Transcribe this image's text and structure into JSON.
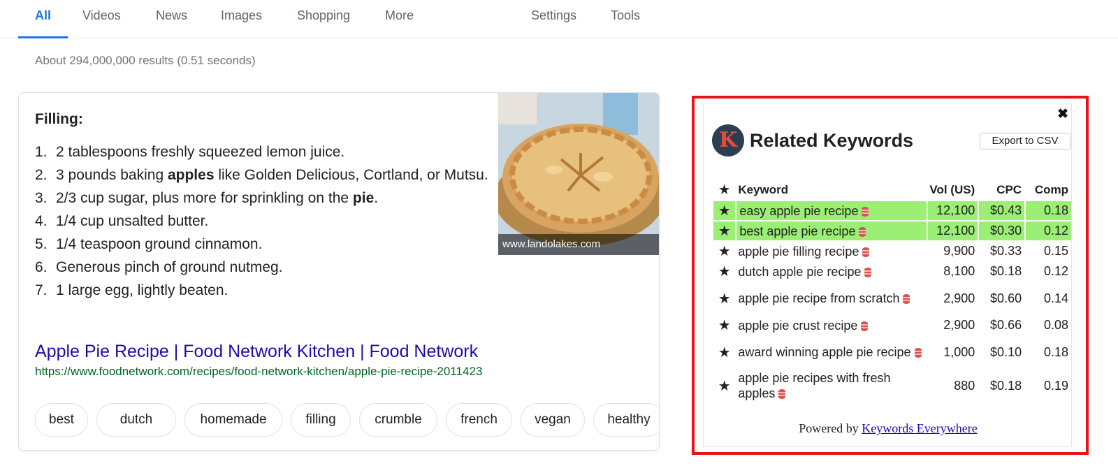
{
  "nav": {
    "tabs": [
      "All",
      "Videos",
      "News",
      "Images",
      "Shopping",
      "More"
    ],
    "right": [
      "Settings",
      "Tools"
    ]
  },
  "stats": "About 294,000,000 results (0.51 seconds)",
  "snippet": {
    "heading": "Filling:",
    "steps": [
      {
        "n": "1.",
        "parts": [
          [
            "2 tablespoons freshly squeezed lemon juice.",
            false
          ]
        ]
      },
      {
        "n": "2.",
        "parts": [
          [
            "3 pounds baking ",
            false
          ],
          [
            "apples",
            true
          ],
          [
            " like Golden Delicious, Cortland, or Mutsu.",
            false
          ]
        ]
      },
      {
        "n": "3.",
        "parts": [
          [
            "2/3 cup sugar, plus more for sprinkling on the ",
            false
          ],
          [
            "pie",
            true
          ],
          [
            ".",
            false
          ]
        ]
      },
      {
        "n": "4.",
        "parts": [
          [
            "1/4 cup unsalted butter.",
            false
          ]
        ]
      },
      {
        "n": "5.",
        "parts": [
          [
            "1/4 teaspoon ground cinnamon.",
            false
          ]
        ]
      },
      {
        "n": "6.",
        "parts": [
          [
            "Generous pinch of ground nutmeg.",
            false
          ]
        ]
      },
      {
        "n": "7.",
        "parts": [
          [
            "1 large egg, lightly beaten.",
            false
          ]
        ]
      }
    ],
    "image_caption": "www.landolakes.com",
    "result_title": "Apple Pie Recipe | Food Network Kitchen | Food Network",
    "result_url": "https://www.foodnetwork.com/recipes/food-network-kitchen/apple-pie-recipe-2011423",
    "chips": [
      "best",
      "dutch",
      "homemade",
      "filling",
      "crumble",
      "french",
      "vegan",
      "healthy"
    ]
  },
  "widget": {
    "logo_letter": "K",
    "title": "Related Keywords",
    "export_label": "Export to CSV",
    "close_glyph": "✖",
    "columns": {
      "keyword": "Keyword",
      "vol": "Vol (US)",
      "cpc": "CPC",
      "comp": "Comp"
    },
    "rows": [
      {
        "keyword": "easy apple pie recipe",
        "vol": "12,100",
        "cpc": "$0.43",
        "comp": "0.18",
        "highlight": true
      },
      {
        "keyword": "best apple pie recipe",
        "vol": "12,100",
        "cpc": "$0.30",
        "comp": "0.12",
        "highlight": true
      },
      {
        "keyword": "apple pie filling recipe",
        "vol": "9,900",
        "cpc": "$0.33",
        "comp": "0.15",
        "highlight": false
      },
      {
        "keyword": "dutch apple pie recipe",
        "vol": "8,100",
        "cpc": "$0.18",
        "comp": "0.12",
        "highlight": false
      },
      {
        "keyword": "apple pie recipe from scratch",
        "vol": "2,900",
        "cpc": "$0.60",
        "comp": "0.14",
        "highlight": false
      },
      {
        "keyword": "apple pie crust recipe",
        "vol": "2,900",
        "cpc": "$0.66",
        "comp": "0.08",
        "highlight": false
      },
      {
        "keyword": "award winning apple pie recipe",
        "vol": "1,000",
        "cpc": "$0.10",
        "comp": "0.18",
        "highlight": false
      },
      {
        "keyword": "apple pie recipes with fresh apples",
        "vol": "880",
        "cpc": "$0.18",
        "comp": "0.19",
        "highlight": false
      }
    ],
    "powered_prefix": "Powered by",
    "powered_link": "Keywords Everywhere"
  },
  "colors": {
    "accent": "#1a73e8",
    "link": "#1a0dab",
    "url": "#006621",
    "highlight": "#9aef74",
    "frame": "#e8121a"
  }
}
